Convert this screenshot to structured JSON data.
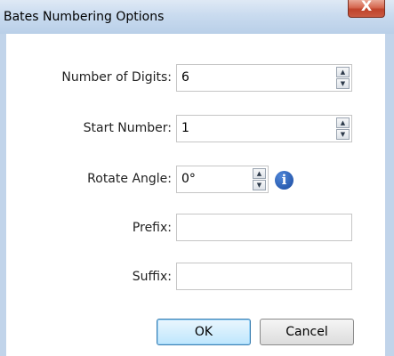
{
  "window": {
    "title": "Bates Numbering Options",
    "close_label": "X"
  },
  "form": {
    "digits_label": "Number of Digits:",
    "digits_value": "6",
    "start_label": "Start Number:",
    "start_value": "1",
    "rotate_label": "Rotate Angle:",
    "rotate_value": "0°",
    "prefix_label": "Prefix:",
    "prefix_value": "",
    "suffix_label": "Suffix:",
    "suffix_value": ""
  },
  "buttons": {
    "ok": "OK",
    "cancel": "Cancel"
  },
  "icons": {
    "spin_up": "▲",
    "spin_down": "▼",
    "info": "i"
  },
  "colors": {
    "titlebar": "#c9dbef",
    "close_button": "#c0432b",
    "info_icon": "#1a4ba0"
  }
}
